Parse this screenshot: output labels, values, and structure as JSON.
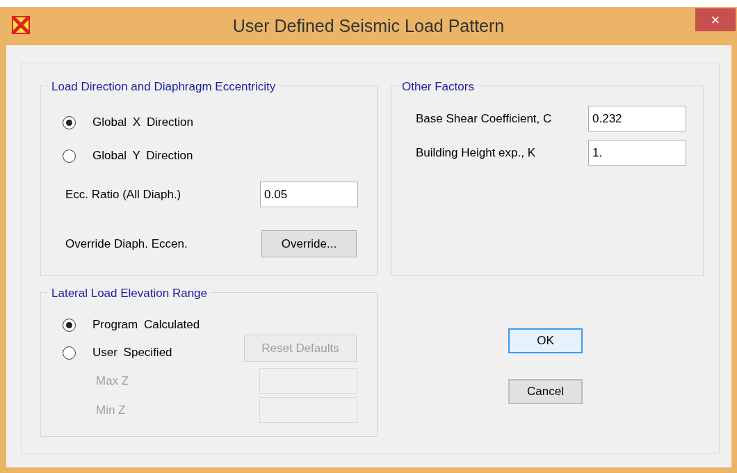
{
  "window": {
    "title": "User Defined Seismic Load Pattern",
    "close": "×"
  },
  "load_direction": {
    "title": "Load Direction and Diaphragm Eccentricity",
    "directions": [
      {
        "label": "Global X Direction",
        "selected": true
      },
      {
        "label": "Global Y Direction",
        "selected": false
      }
    ],
    "ecc_ratio": {
      "label": "Ecc. Ratio (All Diaph.)",
      "value": "0.05"
    },
    "override": {
      "label": "Override Diaph. Eccen.",
      "button": "Override..."
    }
  },
  "other_factors": {
    "title": "Other Factors",
    "fields": [
      {
        "label": "Base Shear Coefficient, C",
        "value": "0.232"
      },
      {
        "label": "Building Height exp., K",
        "value": "1."
      }
    ]
  },
  "elevation_range": {
    "title": "Lateral Load Elevation Range",
    "options": [
      {
        "label": "Program Calculated",
        "selected": true
      },
      {
        "label": "User Specified",
        "selected": false
      }
    ],
    "reset_button": {
      "label": "Reset Defaults",
      "disabled": true
    },
    "fields": [
      {
        "label": "Max Z",
        "disabled": true
      },
      {
        "label": "Min Z",
        "disabled": true
      }
    ]
  },
  "buttons": [
    {
      "label": "OK",
      "focused": true
    },
    {
      "label": "Cancel",
      "focused": false
    }
  ]
}
